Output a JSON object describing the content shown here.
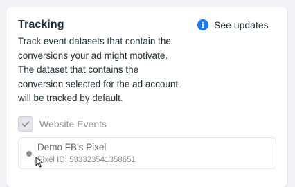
{
  "tracking": {
    "title": "Tracking",
    "see_updates": {
      "icon": "info-icon",
      "icon_glyph": "i",
      "label": "See updates"
    },
    "description": "Track event datasets that contain the conversions your ad might motivate. The dataset that contains the conversion selected for the ad account will be tracked by default.",
    "website_events": {
      "label": "Website Events",
      "checked": true,
      "disabled": true
    },
    "pixel": {
      "name": "Demo FB's Pixel",
      "id_text": "Pixel ID: 533323541358651",
      "status_color": "#8a8d91"
    }
  },
  "colors": {
    "accent": "#1877f2",
    "text_primary": "#1c2b33",
    "text_muted": "#8a8d91",
    "card_background": "#ffffff",
    "page_background": "#f0f2f5"
  }
}
